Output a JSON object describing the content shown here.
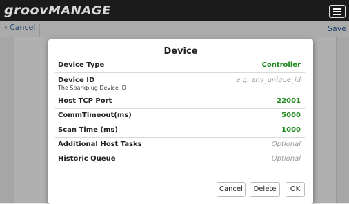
{
  "app": {
    "logo_main": "groov",
    "logo_sub": "MANAGE"
  },
  "nav": {
    "cancel_label": "Cancel",
    "save_label": "Save"
  },
  "dialog": {
    "title": "Device",
    "rows": [
      {
        "label": "Device Type",
        "value": "Controller",
        "kind": "value"
      },
      {
        "label": "Device ID",
        "sublabel": "The Sparkplug Device ID",
        "placeholder": "e.g. any_unique_id",
        "kind": "input"
      },
      {
        "label": "Host TCP Port",
        "value": "22001",
        "kind": "value"
      },
      {
        "label": "CommTimeout(ms)",
        "value": "5000",
        "kind": "value"
      },
      {
        "label": "Scan Time (ms)",
        "value": "1000",
        "kind": "value"
      },
      {
        "label": "Additional Host Tasks",
        "placeholder": "Optional",
        "kind": "input"
      },
      {
        "label": "Historic Queue",
        "placeholder": "Optional",
        "kind": "input"
      }
    ],
    "buttons": {
      "cancel": "Cancel",
      "delete": "Delete",
      "ok": "OK"
    }
  },
  "colors": {
    "value_green": "#1f8a1f",
    "topbar": "#1b1b1b",
    "link_blue": "#2b5d97"
  }
}
